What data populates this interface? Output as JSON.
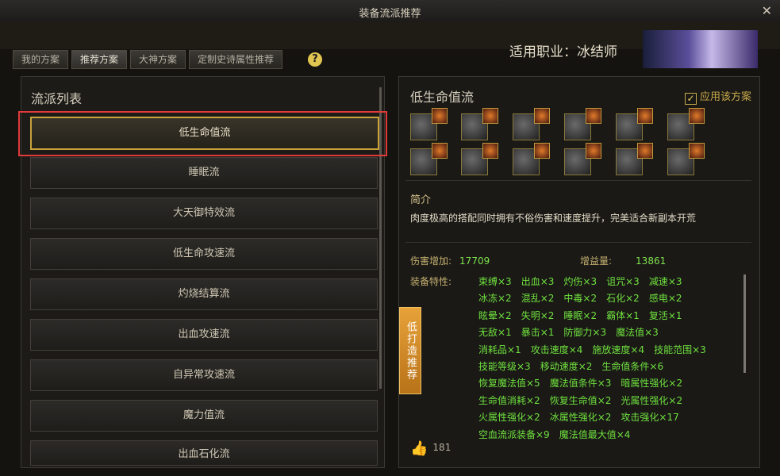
{
  "window": {
    "title": "装备流派推荐",
    "close": "✕"
  },
  "tabs": [
    "我的方案",
    "推荐方案",
    "大神方案",
    "定制史诗属性推荐"
  ],
  "help": "?",
  "job": "适用职业：冰结师",
  "left": {
    "title": "流派列表",
    "items": [
      "低生命值流",
      "睡眠流",
      "大天御特效流",
      "低生命攻速流",
      "灼烧结算流",
      "出血攻速流",
      "自异常攻速流",
      "魔力值流",
      "出血石化流"
    ]
  },
  "right": {
    "title": "低生命值流",
    "apply_check": "✓",
    "apply": "应用该方案",
    "intro_title": "简介",
    "intro": "肉度极高的搭配同时拥有不俗伤害和速度提升，完美适合新副本开荒",
    "damage_label": "伤害增加:",
    "damage_value": "17709",
    "gain_label": "增益量:",
    "gain_value": "13861",
    "traits_label": "装备特性:",
    "traits": [
      [
        "束缚×3",
        "出血×3",
        "灼伤×3",
        "诅咒×3",
        "减速×3"
      ],
      [
        "冰冻×2",
        "混乱×2",
        "中毒×2",
        "石化×2",
        "感电×2"
      ],
      [
        "眩晕×2",
        "失明×2",
        "睡眠×2",
        "霸体×1",
        "复活×1"
      ],
      [
        "无敌×1",
        "暴击×1",
        "防御力×3",
        "魔法值×3"
      ],
      [
        "消耗品×1",
        "攻击速度×4",
        "施放速度×4",
        "技能范围×3"
      ],
      [
        "技能等级×3",
        "移动速度×2",
        "生命值条件×6"
      ],
      [
        "恢复魔法值×5",
        "魔法值条件×3",
        "暗属性强化×2"
      ],
      [
        "生命值消耗×2",
        "恢复生命值×2",
        "光属性强化×2"
      ],
      [
        "火属性强化×2",
        "冰属性强化×2",
        "攻击强化×17"
      ],
      [
        "空血流派装备×9",
        "魔法值最大值×4"
      ]
    ],
    "side_tag": "低打造推荐",
    "likes_icon": "👍",
    "likes": "181"
  },
  "colors": {
    "accent": "#c9a23a",
    "trait_green": "#6fe03e",
    "selection_box": "#e03a3a"
  }
}
